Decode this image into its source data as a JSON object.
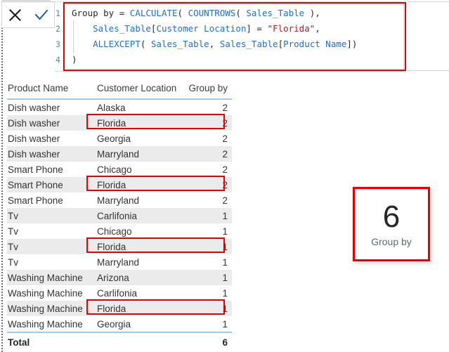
{
  "formula_bar": {
    "cancel_icon": "close-icon",
    "commit_icon": "check-icon",
    "line_numbers": [
      "1",
      "2",
      "3",
      "4"
    ],
    "measure_name": "Group by",
    "assign_op": "=",
    "lines": [
      {
        "n": "1",
        "parts": [
          {
            "t": "id",
            "v": "Group by "
          },
          {
            "t": "op",
            "v": "= "
          },
          {
            "t": "fn",
            "v": "CALCULATE"
          },
          {
            "t": "op",
            "v": "( "
          },
          {
            "t": "fn",
            "v": "COUNTROWS"
          },
          {
            "t": "op",
            "v": "( "
          },
          {
            "t": "fn",
            "v": "Sales_Table"
          },
          {
            "t": "op",
            "v": " ),"
          }
        ]
      },
      {
        "n": "2",
        "parts": [
          {
            "t": "op",
            "v": "    "
          },
          {
            "t": "fn",
            "v": "Sales_Table"
          },
          {
            "t": "op",
            "v": "["
          },
          {
            "t": "fn",
            "v": "Customer Location"
          },
          {
            "t": "op",
            "v": "] = "
          },
          {
            "t": "str",
            "v": "\"Florida\""
          },
          {
            "t": "op",
            "v": ","
          }
        ]
      },
      {
        "n": "3",
        "parts": [
          {
            "t": "op",
            "v": "    "
          },
          {
            "t": "fn",
            "v": "ALLEXCEPT"
          },
          {
            "t": "op",
            "v": "( "
          },
          {
            "t": "fn",
            "v": "Sales_Table"
          },
          {
            "t": "op",
            "v": ", "
          },
          {
            "t": "fn",
            "v": "Sales_Table"
          },
          {
            "t": "op",
            "v": "["
          },
          {
            "t": "fn",
            "v": "Product Name"
          },
          {
            "t": "op",
            "v": "])"
          }
        ]
      },
      {
        "n": "4",
        "parts": [
          {
            "t": "op",
            "v": ")"
          }
        ]
      }
    ]
  },
  "table": {
    "columns": [
      "Product Name",
      "Customer Location",
      "Group by"
    ],
    "rows": [
      {
        "product": "Dish washer",
        "location": "Alaska",
        "value": "2",
        "highlight": false
      },
      {
        "product": "Dish washer",
        "location": "Florida",
        "value": "2",
        "highlight": true
      },
      {
        "product": "Dish washer",
        "location": "Georgia",
        "value": "2",
        "highlight": false
      },
      {
        "product": "Dish washer",
        "location": "Marryland",
        "value": "2",
        "highlight": false
      },
      {
        "product": "Smart Phone",
        "location": "Chicago",
        "value": "2",
        "highlight": false
      },
      {
        "product": "Smart Phone",
        "location": "Florida",
        "value": "2",
        "highlight": true
      },
      {
        "product": "Smart Phone",
        "location": "Marryland",
        "value": "2",
        "highlight": false
      },
      {
        "product": "Tv",
        "location": "Carlifonia",
        "value": "1",
        "highlight": false
      },
      {
        "product": "Tv",
        "location": "Chicago",
        "value": "1",
        "highlight": false
      },
      {
        "product": "Tv",
        "location": "Florida",
        "value": "1",
        "highlight": true
      },
      {
        "product": "Tv",
        "location": "Marryland",
        "value": "1",
        "highlight": false
      },
      {
        "product": "Washing Machine",
        "location": "Arizona",
        "value": "1",
        "highlight": false
      },
      {
        "product": "Washing Machine",
        "location": "Carlifonia",
        "value": "1",
        "highlight": false
      },
      {
        "product": "Washing Machine",
        "location": "Florida",
        "value": "1",
        "highlight": true
      },
      {
        "product": "Washing Machine",
        "location": "Georgia",
        "value": "1",
        "highlight": false
      }
    ],
    "total_label": "Total",
    "total_value": "6"
  },
  "card": {
    "value": "6",
    "label": "Group by"
  },
  "colors": {
    "highlight_red": "#e60000",
    "header_rule_blue": "#9ecbe8",
    "function_blue": "#1f6fc4",
    "string_red": "#9b2226",
    "line_number": "#4a8fa8",
    "alt_row": "#ebebeb"
  }
}
